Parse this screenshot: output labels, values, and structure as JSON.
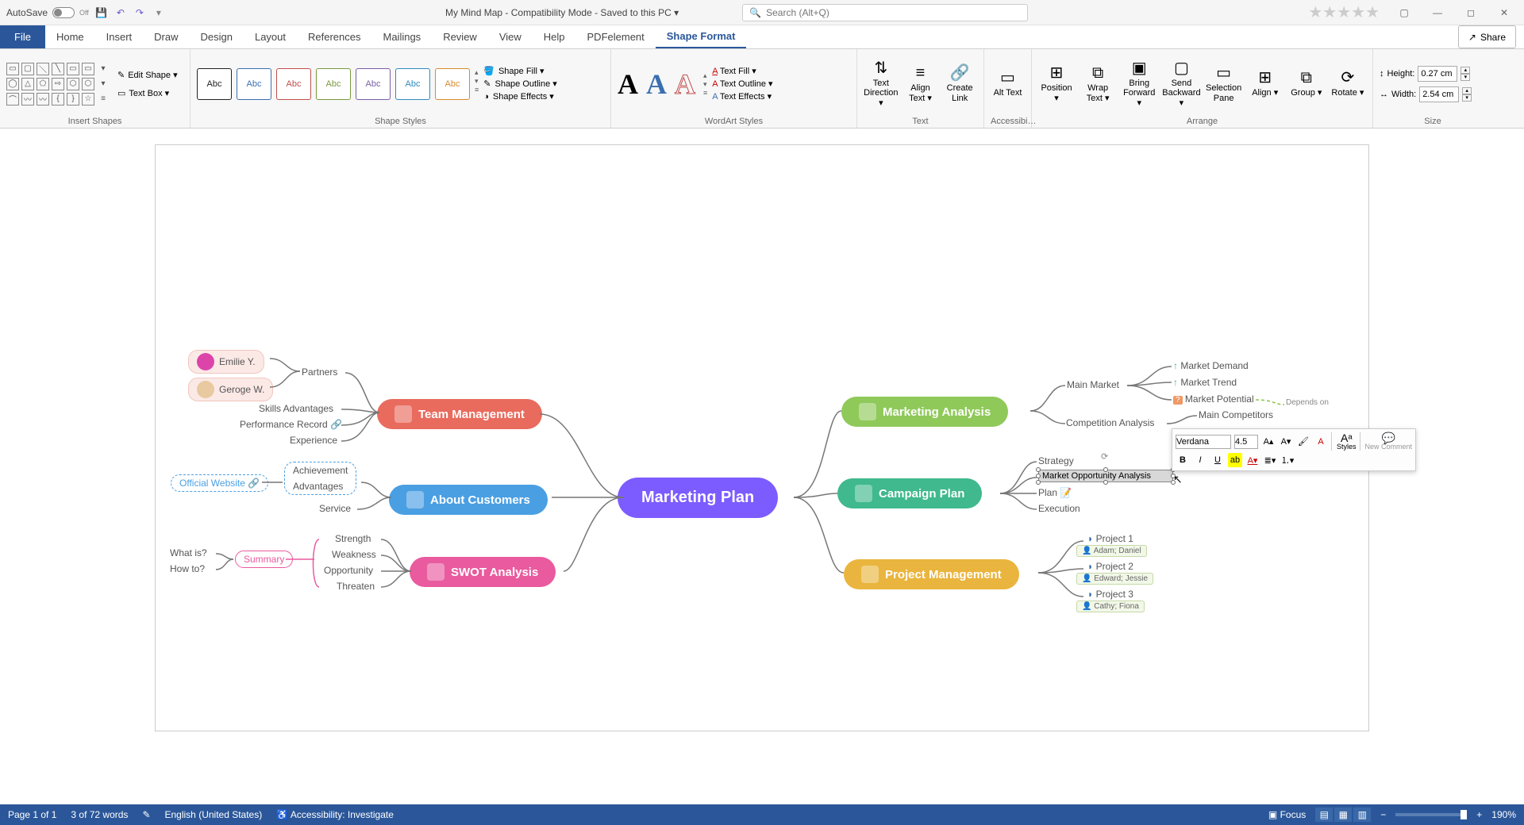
{
  "titlebar": {
    "autosave_label": "AutoSave",
    "autosave_state": "Off",
    "doc_title": "My Mind Map  -  Compatibility Mode  -  Saved to this PC ▾",
    "search_placeholder": "Search (Alt+Q)"
  },
  "tabs": {
    "file": "File",
    "items": [
      "Home",
      "Insert",
      "Draw",
      "Design",
      "Layout",
      "References",
      "Mailings",
      "Review",
      "View",
      "Help",
      "PDFelement",
      "Shape Format"
    ],
    "active": "Shape Format",
    "share": "Share"
  },
  "ribbon": {
    "insert_shapes": {
      "label": "Insert Shapes",
      "edit_shape": "Edit Shape ▾",
      "text_box": "Text Box ▾"
    },
    "shape_styles": {
      "label": "Shape Styles",
      "swatches": [
        "Abc",
        "Abc",
        "Abc",
        "Abc",
        "Abc",
        "Abc",
        "Abc"
      ],
      "swatch_colors": [
        "#222",
        "#3a6fb0",
        "#c0504d",
        "#7a9a3e",
        "#7a5fa8",
        "#2f8bbf",
        "#d88b2e"
      ],
      "fill": "Shape Fill ▾",
      "outline": "Shape Outline ▾",
      "effects": "Shape Effects ▾"
    },
    "wordart": {
      "label": "WordArt Styles",
      "fill": "Text Fill ▾",
      "outline": "Text Outline ▾",
      "effects": "Text Effects ▾"
    },
    "text": {
      "label": "Text",
      "direction": "Text Direction ▾",
      "align": "Align Text ▾",
      "link": "Create Link"
    },
    "accessibility": {
      "label": "Accessibi…",
      "alt": "Alt Text"
    },
    "arrange": {
      "label": "Arrange",
      "position": "Position ▾",
      "wrap": "Wrap Text ▾",
      "forward": "Bring Forward ▾",
      "backward": "Send Backward ▾",
      "selection": "Selection Pane",
      "align": "Align ▾",
      "group": "Group ▾",
      "rotate": "Rotate ▾"
    },
    "size": {
      "label": "Size",
      "height_label": "Height:",
      "height": "0.27 cm",
      "width_label": "Width:",
      "width": "2.54 cm"
    }
  },
  "mindmap": {
    "center": "Marketing Plan",
    "left": {
      "team": {
        "title": "Team Management",
        "partners_label": "Partners",
        "partners": [
          "Emilie Y.",
          "Geroge W."
        ],
        "items": [
          "Skills Advantages",
          "Performance Record",
          "Experience"
        ]
      },
      "customers": {
        "title": "About Customers",
        "website": "Official Website",
        "items": [
          "Achievement",
          "Advantages",
          "Service"
        ]
      },
      "swot": {
        "title": "SWOT Analysis",
        "summary": "Summary",
        "q1": "What is?",
        "q2": "How to?",
        "items": [
          "Strength",
          "Weakness",
          "Opportunity",
          "Threaten"
        ]
      }
    },
    "right": {
      "analysis": {
        "title": "Marketing Analysis",
        "main_market": "Main Market",
        "competition": "Competition Analysis",
        "demand": "Market Demand",
        "trend": "Market Trend",
        "potential": "Market Potential",
        "depends": "Depends on",
        "main_competitors": "Main Competitors"
      },
      "campaign": {
        "title": "Campaign Plan",
        "items": [
          "Strategy",
          "Market Opportunity Analysis",
          "Plan",
          "Execution"
        ]
      },
      "project": {
        "title": "Project Management",
        "p1": "Project 1",
        "p1_people": "Adam; Daniel",
        "p2": "Project 2",
        "p2_people": "Edward; Jessie",
        "p3": "Project 3",
        "p3_people": "Cathy; Fiona"
      }
    }
  },
  "mini_toolbar": {
    "font": "Verdana",
    "size": "4.5",
    "styles_label": "Styles",
    "new_comment": "New Comment"
  },
  "statusbar": {
    "page": "Page 1 of 1",
    "words": "3 of 72 words",
    "lang": "English (United States)",
    "accessibility": "Accessibility: Investigate",
    "focus": "Focus",
    "zoom": "190%"
  }
}
